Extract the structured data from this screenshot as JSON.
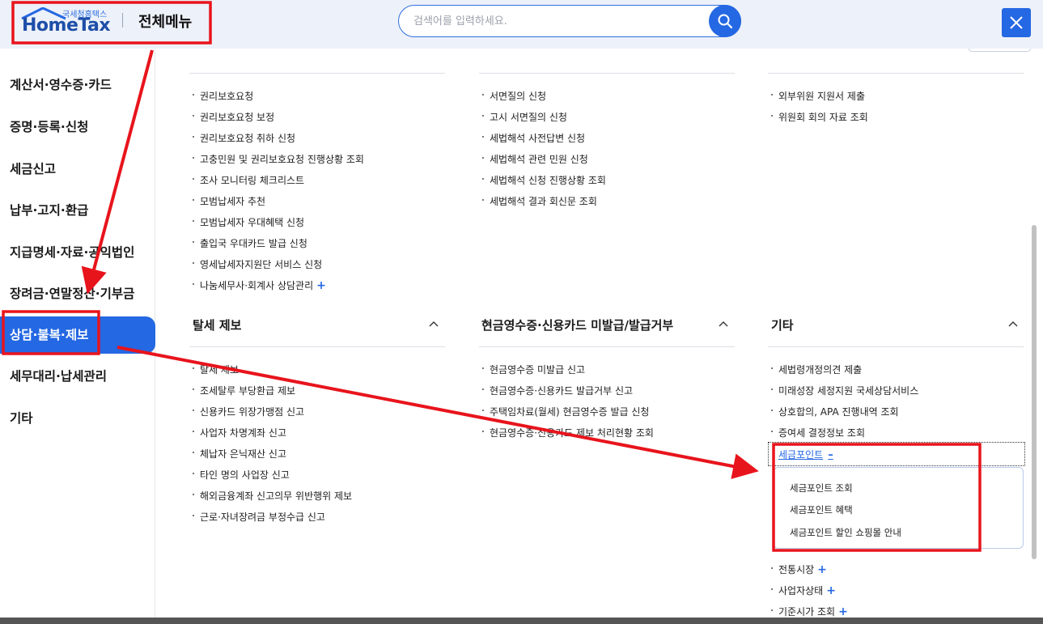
{
  "header": {
    "logo_caption": "국세청홈택스",
    "logo_text": "HomeTax",
    "title": "전체메뉴",
    "search_placeholder": "검색어를 입력하세요.",
    "search_icon": "search-icon",
    "close_icon": "close-icon"
  },
  "sidebar": {
    "items": [
      {
        "label": "계산서·영수증·카드",
        "active": false
      },
      {
        "label": "증명·등록·신청",
        "active": false
      },
      {
        "label": "세금신고",
        "active": false
      },
      {
        "label": "납부·고지·환급",
        "active": false
      },
      {
        "label": "지급명세·자료·공익법인",
        "active": false
      },
      {
        "label": "장려금·연말정산·기부금",
        "active": false
      },
      {
        "label": "상담·불복·제보",
        "active": true
      },
      {
        "label": "세무대리·납세관리",
        "active": false
      },
      {
        "label": "기타",
        "active": false
      }
    ]
  },
  "upper": {
    "col1": [
      "권리보호요청",
      "권리보호요청 보정",
      "권리보호요청 취하 신청",
      "고충민원 및 권리보호요청 진행상황 조회",
      "조사 모니터링 체크리스트",
      "모범납세자 추천",
      "모범납세자 우대혜택 신청",
      "출입국 우대카드 발급 신청",
      "영세납세자지원단 서비스 신청",
      "나눔세무사·회계사 상담관리"
    ],
    "col2": [
      "서면질의 신청",
      "고시 서면질의 신청",
      "세법해석 사전답변 신청",
      "세법해석 관련 민원 신청",
      "세법해석 신청 진행상황 조회",
      "세법해석 결과 회신문 조회"
    ],
    "col3": [
      "외부위원 지원서 제출",
      "위원회 회의 자료 조회"
    ]
  },
  "sections": {
    "tax_evasion": {
      "title": "탈세 제보",
      "items": [
        "탈세 제보",
        "조세탈루 부당환급 제보",
        "신용카드 위장가맹점 신고",
        "사업자 차명계좌 신고",
        "체납자 은닉재산 신고",
        "타인 명의 사업장 신고",
        "해외금융계좌 신고의무 위반행위 제보",
        "근로·자녀장려금 부정수급 신고"
      ]
    },
    "cash_receipt": {
      "title": "현금영수증·신용카드 미발급/발급거부",
      "items": [
        "현금영수증 미발급 신고",
        "현금영수증·신용카드 발급거부 신고",
        "주택임차료(월세) 현금영수증 발급 신청",
        "현금영수증·신용카드 제보 처리현황 조회"
      ]
    },
    "etc": {
      "title": "기타",
      "items": [
        "세법령개정의견 제출",
        "미래성장 세정지원 국세상담서비스",
        "상호합의, APA 진행내역 조회",
        "증여세 결정정보 조회"
      ],
      "tax_point": {
        "label": "세금포인트",
        "sub_items": [
          "세금포인트 조회",
          "세금포인트 혜택",
          "세금포인트 할인 쇼핑몰 안내"
        ]
      },
      "more_items": [
        "전통시장",
        "사업자상태",
        "기준시가 조회"
      ]
    }
  },
  "colors": {
    "accent": "#2468e3",
    "annotation": "#e8141c"
  }
}
